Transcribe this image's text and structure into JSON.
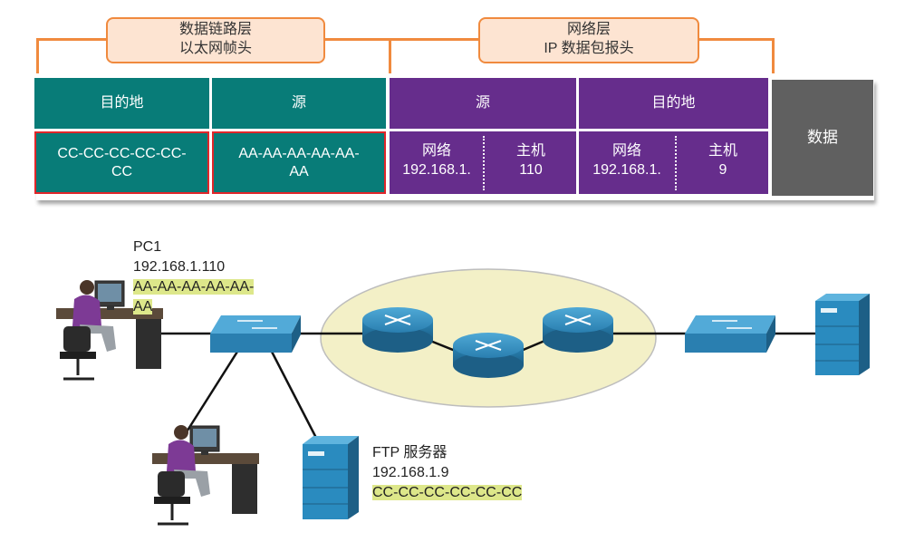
{
  "header": {
    "datalink_label": "数据链路层\n以太网帧头",
    "network_label": "网络层\nIP 数据包报头"
  },
  "frame": {
    "eth_dest_title": "目的地",
    "eth_src_title": "源",
    "ip_src_title": "源",
    "ip_dest_title": "目的地",
    "data_label": "数据",
    "eth_dest_mac": "CC-CC-CC-CC-CC-\nCC",
    "eth_src_mac": "AA-AA-AA-AA-AA-\nAA",
    "ip_src_net_label": "网络",
    "ip_src_net_value": "192.168.1.",
    "ip_src_host_label": "主机",
    "ip_src_host_value": "110",
    "ip_dest_net_label": "网络",
    "ip_dest_net_value": "192.168.1.",
    "ip_dest_host_label": "主机",
    "ip_dest_host_value": "9"
  },
  "pc1": {
    "name": "PC1",
    "ip": "192.168.1.110",
    "mac": "AA-AA-AA-AA-AA-\nAA"
  },
  "ftp": {
    "name": "FTP 服务器",
    "ip": "192.168.1.9",
    "mac": "CC-CC-CC-CC-CC-CC"
  },
  "colors": {
    "teal": "#087c78",
    "purple": "#662d8c",
    "grey": "#606060",
    "orange": "#f08a3e",
    "highlight": "#dde78a",
    "device_blue": "#2a8bbf"
  }
}
